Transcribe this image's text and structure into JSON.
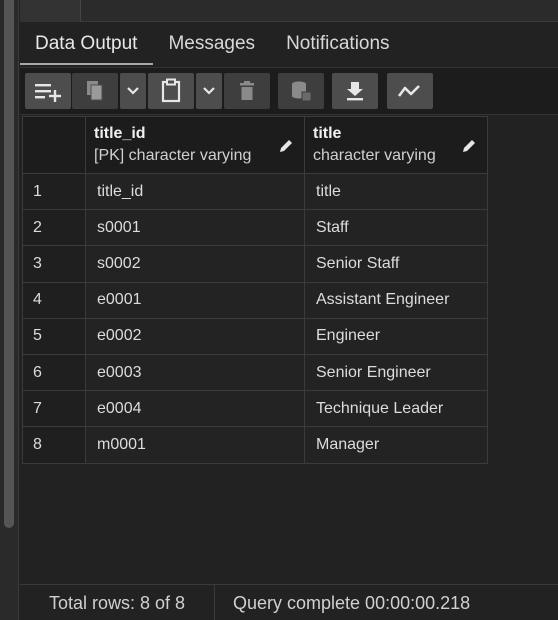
{
  "tabs": [
    {
      "label": "Data Output",
      "active": true
    },
    {
      "label": "Messages",
      "active": false
    },
    {
      "label": "Notifications",
      "active": false
    }
  ],
  "toolbar": {
    "icons": [
      "add-row-icon",
      "copy-icon",
      "chevron-down-icon",
      "paste-icon",
      "chevron-down-icon",
      "delete-icon",
      "save-data-icon",
      "download-icon",
      "graph-icon"
    ]
  },
  "grid": {
    "columns": [
      {
        "name": "title_id",
        "type": "[PK] character varying"
      },
      {
        "name": "title",
        "type": "character varying"
      }
    ],
    "rows": [
      {
        "n": "1",
        "title_id": "title_id",
        "title": "title"
      },
      {
        "n": "2",
        "title_id": "s0001",
        "title": "Staff"
      },
      {
        "n": "3",
        "title_id": "s0002",
        "title": "Senior Staff"
      },
      {
        "n": "4",
        "title_id": "e0001",
        "title": "Assistant Engineer"
      },
      {
        "n": "5",
        "title_id": "e0002",
        "title": "Engineer"
      },
      {
        "n": "6",
        "title_id": "e0003",
        "title": "Senior Engineer"
      },
      {
        "n": "7",
        "title_id": "e0004",
        "title": "Technique Leader"
      },
      {
        "n": "8",
        "title_id": "m0001",
        "title": "Manager"
      }
    ]
  },
  "status": {
    "total_rows": "Total rows: 8 of 8",
    "query": "Query complete 00:00:00.218"
  }
}
